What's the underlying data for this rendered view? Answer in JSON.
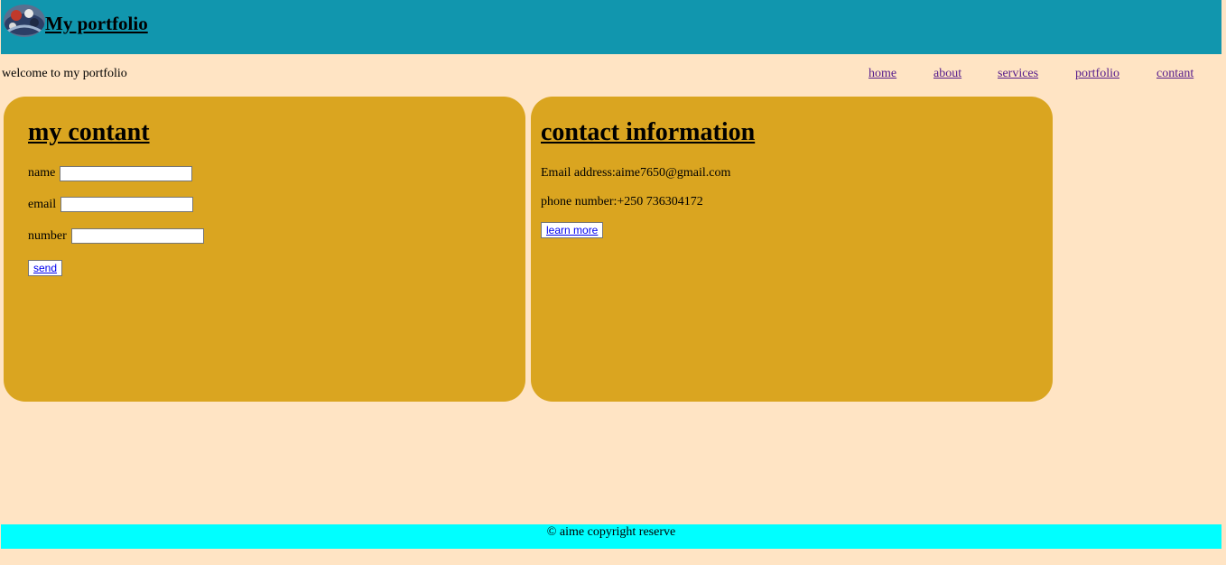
{
  "header": {
    "title": "My portfolio",
    "logo_icon": "logo-avatar-icon",
    "bg_color": "#1196ae"
  },
  "welcome": "welcome to my portfolio",
  "nav": {
    "items": [
      {
        "label": "home"
      },
      {
        "label": "about"
      },
      {
        "label": "services"
      },
      {
        "label": "portfolio"
      },
      {
        "label": "contant"
      }
    ]
  },
  "contact_form": {
    "title": "my contant",
    "name_label": "name",
    "name_value": "",
    "email_label": "email",
    "email_value": "",
    "number_label": "number",
    "number_value": "",
    "send_label": "send"
  },
  "contact_info": {
    "title": "contact information",
    "email_line": "Email address:aime7650@gmail.com",
    "phone_line": "phone number:+250 736304172",
    "learn_more_label": "learn more"
  },
  "footer": {
    "text": "© aime copyright reserve",
    "bg_color": "#00ffff"
  },
  "colors": {
    "page_bg": "#ffe4c4",
    "panel_bg": "#daa520"
  }
}
